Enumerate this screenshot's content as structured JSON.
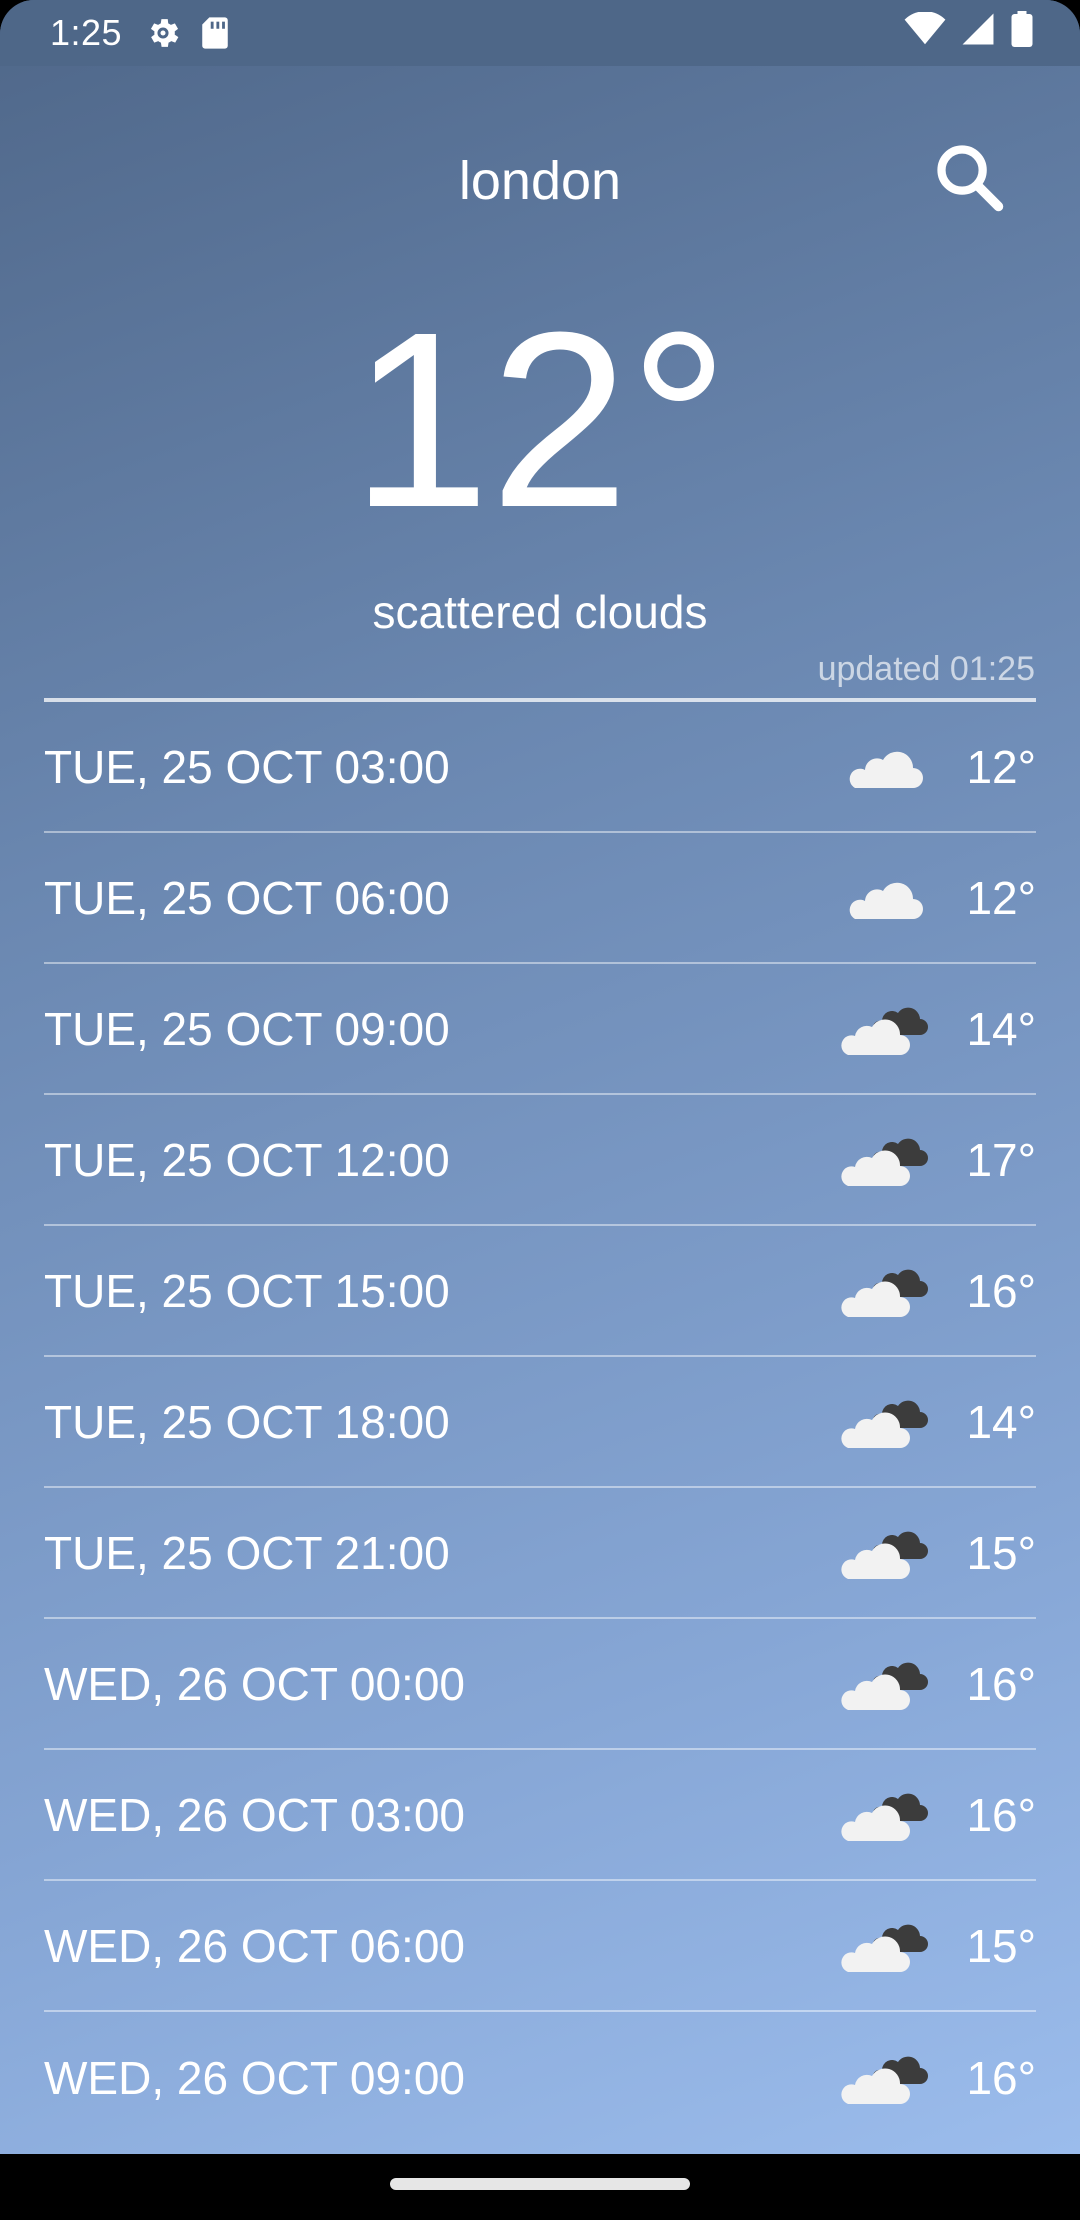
{
  "status_bar": {
    "time": "1:25",
    "icons": [
      "settings-gear-icon",
      "sd-card-icon",
      "wifi-icon",
      "signal-icon",
      "battery-icon"
    ]
  },
  "header": {
    "city": "london",
    "search_icon": "search-icon"
  },
  "current": {
    "temperature": "12°",
    "description": "scattered clouds",
    "updated": "updated 01:25"
  },
  "forecast": [
    {
      "datetime": "TUE, 25 OCT 03:00",
      "icon": "cloud-icon",
      "temp": "12°"
    },
    {
      "datetime": "TUE, 25 OCT 06:00",
      "icon": "cloud-icon",
      "temp": "12°"
    },
    {
      "datetime": "TUE, 25 OCT 09:00",
      "icon": "broken-clouds-icon",
      "temp": "14°"
    },
    {
      "datetime": "TUE, 25 OCT 12:00",
      "icon": "broken-clouds-icon",
      "temp": "17°"
    },
    {
      "datetime": "TUE, 25 OCT 15:00",
      "icon": "broken-clouds-icon",
      "temp": "16°"
    },
    {
      "datetime": "TUE, 25 OCT 18:00",
      "icon": "broken-clouds-icon",
      "temp": "14°"
    },
    {
      "datetime": "TUE, 25 OCT 21:00",
      "icon": "broken-clouds-icon",
      "temp": "15°"
    },
    {
      "datetime": "WED, 26 OCT 00:00",
      "icon": "broken-clouds-icon",
      "temp": "16°"
    },
    {
      "datetime": "WED, 26 OCT 03:00",
      "icon": "broken-clouds-icon",
      "temp": "16°"
    },
    {
      "datetime": "WED, 26 OCT 06:00",
      "icon": "broken-clouds-icon",
      "temp": "15°"
    },
    {
      "datetime": "WED, 26 OCT 09:00",
      "icon": "broken-clouds-icon",
      "temp": "16°"
    }
  ],
  "colors": {
    "background_top": "#4f6789",
    "background_bottom": "#9bbcec",
    "cloud_light": "#f2f2f2",
    "cloud_dark": "#3c3c3c"
  }
}
